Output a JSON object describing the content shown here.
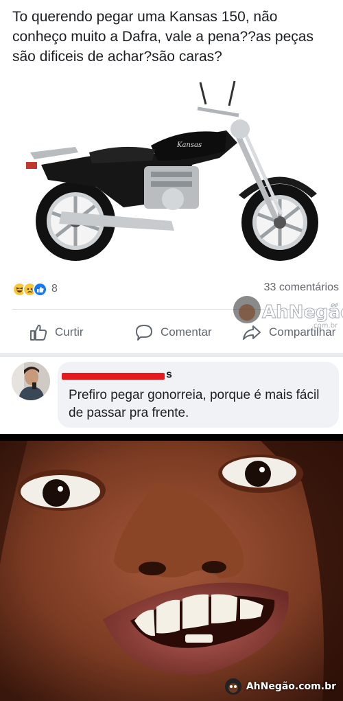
{
  "post": {
    "text": "To querendo pegar uma Kansas 150, não conheço muito a Dafra, vale a pena??as peças são dificeis de achar?são caras?",
    "bike_badge": "Kansas"
  },
  "reactions": {
    "icons": [
      "haha-icon",
      "sad-icon",
      "like-icon"
    ],
    "count": "8",
    "comments": "33 comentários"
  },
  "actions": {
    "like": "Curtir",
    "comment": "Comentar",
    "share": "Compartilhar"
  },
  "watermark": {
    "brand": "AhNegão!",
    "sub": ".com.br"
  },
  "comment": {
    "author_visible_suffix": "s",
    "text": "Prefiro pegar gonorreia, porque é mais fácil de passar pra frente."
  },
  "footer": {
    "brand": "AhNegão.com.br"
  },
  "colors": {
    "facebook_blue": "#1877f2",
    "reaction_yellow": "#f7c63b",
    "redaction_red": "#e8191d",
    "bubble_gray": "#f0f2f5"
  }
}
